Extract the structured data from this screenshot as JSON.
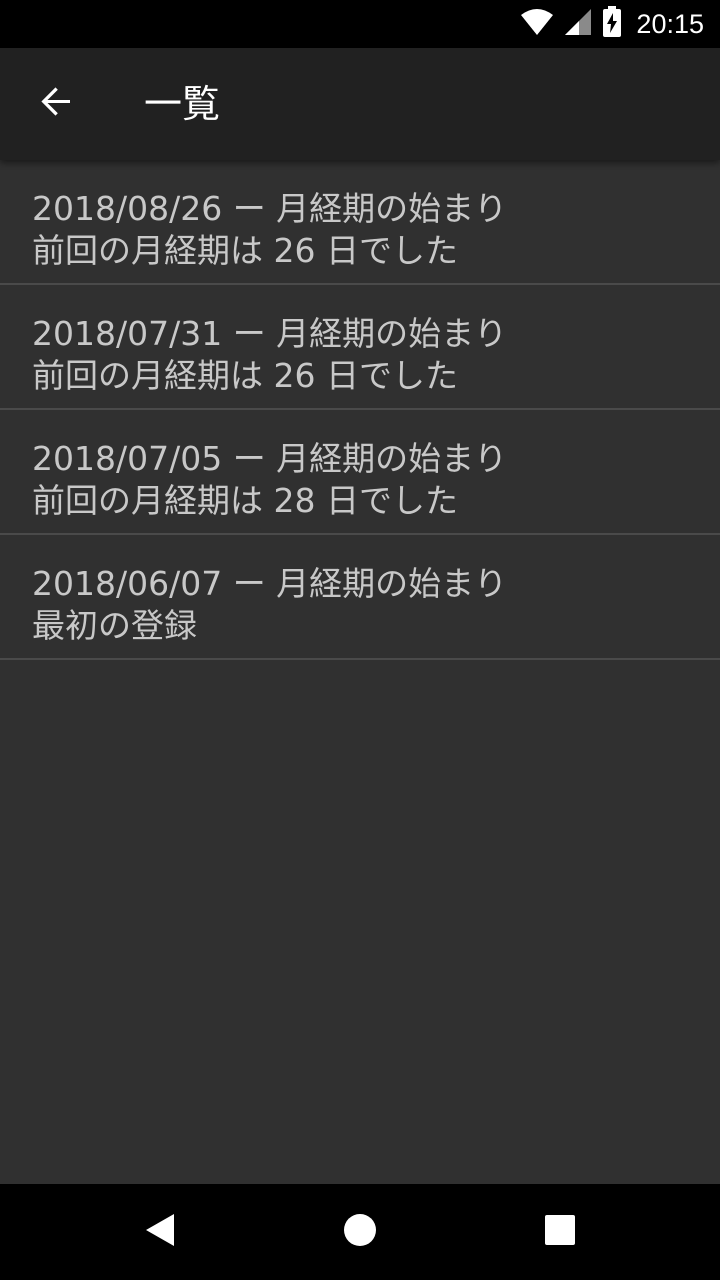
{
  "status_bar": {
    "time": "20:15",
    "icons": [
      "wifi-icon",
      "cell-signal-icon",
      "battery-charging-icon"
    ]
  },
  "app_bar": {
    "title": "一覧",
    "back_icon": "arrow-left-icon"
  },
  "list": {
    "items": [
      {
        "line1": "2018/08/26 ー 月経期の始まり",
        "line2": "前回の月経期は 26 日でした"
      },
      {
        "line1": "2018/07/31 ー 月経期の始まり",
        "line2": "前回の月経期は 26 日でした"
      },
      {
        "line1": "2018/07/05 ー 月経期の始まり",
        "line2": "前回の月経期は 28 日でした"
      },
      {
        "line1": "2018/06/07 ー 月経期の始まり",
        "line2": "最初の登録"
      }
    ]
  },
  "nav_bar": {
    "icons": [
      "back-triangle-icon",
      "home-circle-icon",
      "recents-square-icon"
    ]
  },
  "colors": {
    "background": "#303030",
    "app_bar": "#212121",
    "status_bar": "#000000",
    "text": "#c8c8c8",
    "divider": "#4a4a4a"
  }
}
